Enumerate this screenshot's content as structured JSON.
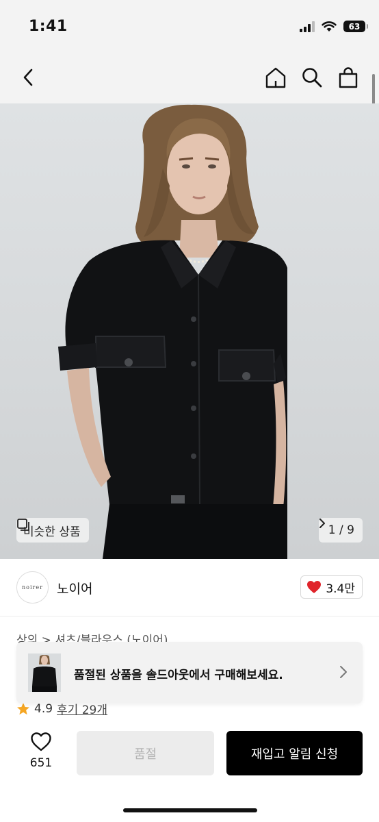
{
  "status_bar": {
    "time": "1:41",
    "battery": "63"
  },
  "nav": {
    "back_icon": "chevron-left-icon",
    "home_icon": "home-icon",
    "search_icon": "search-icon",
    "bag_icon": "shopping-bag-icon"
  },
  "gallery": {
    "similar_label": "비슷한 상품",
    "current_page": "1",
    "total_pages": "9",
    "page_separator": " / "
  },
  "brand": {
    "logo_text": "noirer",
    "name": "노이어",
    "like_count": "3.4만"
  },
  "breadcrumb": {
    "text": "상의 > 셔츠/블라우스 (노이어)"
  },
  "banner": {
    "message": "품절된 상품을 솔드아웃에서 구매해보세요."
  },
  "rating": {
    "score": "4.9",
    "reviews": "후기 29개"
  },
  "bottom_bar": {
    "wish_count": "651",
    "soldout_label": "품절",
    "restock_label": "재입고 알림 신청"
  },
  "colors": {
    "accent": "#000000",
    "heart": "#e0242b",
    "star": "#f5a623",
    "nav_bg": "#f3f3f3"
  }
}
